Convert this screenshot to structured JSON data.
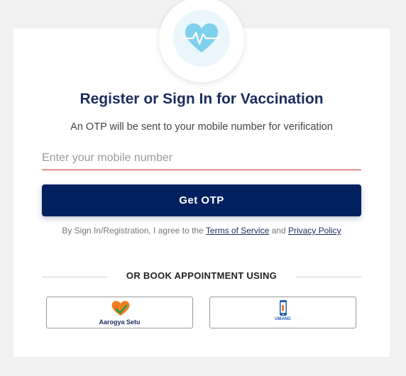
{
  "logo": {
    "icon": "heart-pulse-icon",
    "color": "#7fd0ec"
  },
  "title": "Register or Sign In for Vaccination",
  "subtitle": "An OTP will be sent to your mobile number for verification",
  "mobile_input": {
    "placeholder": "Enter your mobile number",
    "value": ""
  },
  "get_otp_label": "Get OTP",
  "consent": {
    "prefix": "By Sign In/Registration, I agree to the ",
    "terms_link": "Terms of Service",
    "and": " and ",
    "privacy_link": "Privacy Policy"
  },
  "or_book_label": "OR BOOK APPOINTMENT USING",
  "apps": {
    "aarogya": {
      "label": "Aarogya Setu",
      "icon": "aarogya-setu-logo-icon"
    },
    "umang": {
      "label": "UMANG",
      "icon": "umang-logo-icon"
    }
  },
  "colors": {
    "primary": "#002060",
    "title": "#1b2d5e",
    "input_underline": "#d32f2f"
  }
}
